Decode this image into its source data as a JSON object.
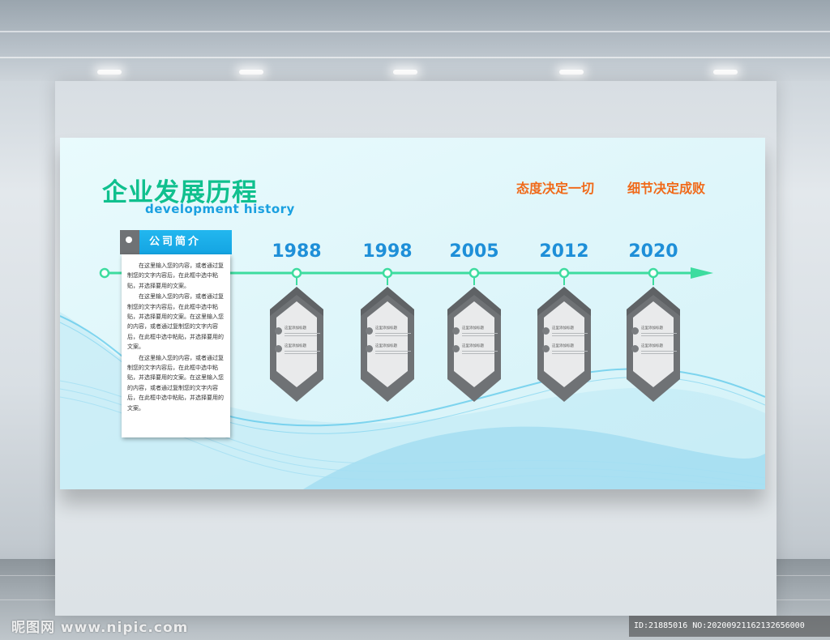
{
  "title_cn": "企业发展历程",
  "title_en": "development history",
  "slogans": [
    "态度决定一切",
    "细节决定成败"
  ],
  "intro": {
    "heading": "公司简介",
    "paragraphs": [
      "在这里输入您的内容，或者通过复制您的文字内容后，在此框中选中粘贴，并选择要用的文案。",
      "在这里输入您的内容，或者通过复制您的文字内容后，在此框中选中粘贴，并选择要用的文案。在这里输入您的内容，或者通过复制您的文字内容后，在此框中选中粘贴，并选择要用的文案。",
      "在这里输入您的内容，或者通过复制您的文字内容后，在此框中选中粘贴，并选择要用的文案。在这里输入您的内容，或者通过复制您的文字内容后，在此框中选中粘贴，并选择要用的文案。"
    ]
  },
  "milestones": [
    {
      "year": "1988",
      "label_1": "这里添加标题",
      "label_2": "这里添加标题"
    },
    {
      "year": "1998",
      "label_1": "这里添加标题",
      "label_2": "这里添加标题"
    },
    {
      "year": "2005",
      "label_1": "这里添加标题",
      "label_2": "这里添加标题"
    },
    {
      "year": "2012",
      "label_1": "这里添加标题",
      "label_2": "这里添加标题"
    },
    {
      "year": "2020",
      "label_1": "这里添加标题",
      "label_2": "这里添加标题"
    }
  ],
  "watermark_left": "昵图网 www.nipic.com",
  "watermark_right": "ID:21885016 NO:20200921162132656000",
  "colors": {
    "title_green": "#10c08e",
    "accent_blue": "#1e8fd8",
    "slogan_orange": "#f06a1a",
    "axis_green": "#3ddc9f",
    "card_gray": "#6f7275"
  }
}
